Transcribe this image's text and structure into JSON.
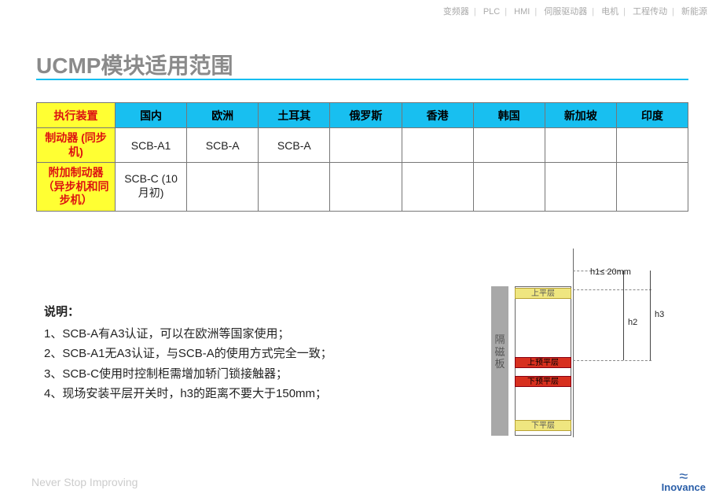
{
  "topnav": [
    "变频器",
    "PLC",
    "HMI",
    "伺服驱动器",
    "电机",
    "工程传动",
    "新能源"
  ],
  "title": "UCMP模块适用范围",
  "table": {
    "corner": "执行装置",
    "cols": [
      "国内",
      "欧洲",
      "土耳其",
      "俄罗斯",
      "香港",
      "韩国",
      "新加坡",
      "印度"
    ],
    "rows": [
      {
        "head": "制动器 (同步机)",
        "cells": [
          "SCB-A1",
          "SCB-A",
          "SCB-A",
          "",
          "",
          "",
          "",
          ""
        ]
      },
      {
        "head": "附加制动器（异步机和同步机）",
        "cells": [
          "SCB-C (10月初)",
          "",
          "",
          "",
          "",
          "",
          "",
          ""
        ]
      }
    ]
  },
  "notes": {
    "header": "说明：",
    "lines": [
      "1、SCB-A有A3认证，可以在欧洲等国家使用；",
      "2、SCB-A1无A3认证，与SCB-A的使用方式完全一致；",
      "3、SCB-C使用时控制柜需增加轿门锁接触器；",
      "4、现场安装平层开关时，h3的距离不要大于150mm；"
    ]
  },
  "diagram": {
    "shield": "隔磁板",
    "labels": {
      "top": "上平层",
      "up": "上预平层",
      "down": "下预平层",
      "bottom": "下平层"
    },
    "dims": {
      "h1": "h1≤ 20mm",
      "h2": "h2",
      "h3": "h3"
    }
  },
  "footer": {
    "slogan": "Never Stop Improving",
    "brand": "Inovance"
  }
}
